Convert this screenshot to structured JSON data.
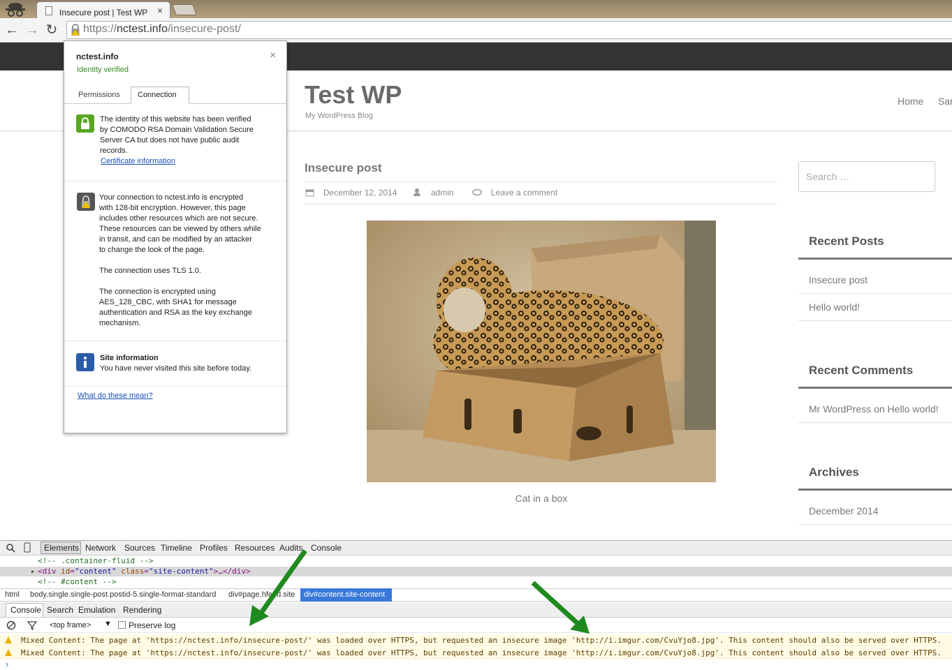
{
  "browser": {
    "tab_title": "Insecure post | Test WP",
    "tab_close": "×",
    "url_scheme": "https://",
    "url_host": "nctest.info",
    "url_path": "/insecure-post/",
    "nav_icons": [
      "back-icon",
      "forward-icon",
      "reload-icon",
      "warning-lock-icon"
    ]
  },
  "site": {
    "title": "Test WP",
    "tagline": "My WordPress Blog",
    "nav": [
      "Home",
      "Sar"
    ],
    "post": {
      "title": "Insecure post",
      "date": "December 12, 2014",
      "author": "admin",
      "comment_link": "Leave a comment",
      "caption": "Cat in a box"
    },
    "sidebar": {
      "search_placeholder": "Search …",
      "recent_posts_title": "Recent Posts",
      "recent_posts": [
        "Insecure post",
        "Hello world!"
      ],
      "recent_comments_title": "Recent Comments",
      "recent_comment": "Mr WordPress on Hello world!",
      "archives_title": "Archives",
      "archives": [
        "December 2014"
      ]
    }
  },
  "popup": {
    "domain": "nctest.info",
    "status": "Identity verified",
    "close": "×",
    "tabs": [
      "Permissions",
      "Connection"
    ],
    "identity_lines": [
      "The identity of this website has been verified",
      "by COMODO RSA Domain Validation Secure",
      "Server CA but does not have public audit",
      "records."
    ],
    "cert_link": "Certificate information",
    "conn_lines": [
      "Your connection to nctest.info is encrypted",
      "with 128-bit encryption. However, this page",
      "includes other resources which are not secure.",
      "These resources can be viewed by others while",
      "in transit, and can be modified by an attacker",
      "to change the look of the page."
    ],
    "tls_line": "The connection uses TLS 1.0.",
    "cipher_lines": [
      "The connection is encrypted using",
      "AES_128_CBC, with SHA1 for message",
      "authentication and RSA as the key exchange",
      "mechanism."
    ],
    "site_info_title": "Site information",
    "site_info_text": "You have never visited this site before today.",
    "help_link": "What do these mean?"
  },
  "devtools": {
    "tabs": [
      "Elements",
      "Network",
      "Sources",
      "Timeline",
      "Profiles",
      "Resources",
      "Audits",
      "Console"
    ],
    "dom_lines": [
      "<!-- .container-fluid -->",
      "<!-- #content -->"
    ],
    "sel_tag_open": "<div ",
    "sel_attr1_name": "id",
    "sel_attr1_val": "\"content\"",
    "sel_attr2_name": "class",
    "sel_attr2_val": "\"site-content\"",
    "sel_tag_close": ">…</div>",
    "breadcrumbs": [
      "html",
      "body.single.single-post.postid-5.single-format-standard",
      "div#page.hfeed.site",
      "div#content.site-content"
    ],
    "drawer_tabs": [
      "Console",
      "Search",
      "Emulation",
      "Rendering"
    ],
    "frame": "<top frame>",
    "preserve_log": "Preserve log",
    "messages": [
      {
        "prefix": "Mixed Content: The page at '",
        "page_url": "https://nctest.info/insecure-post/",
        "middle": "' was loaded over HTTPS, but requested an insecure image '",
        "img_url": "http://i.imgur.com/CvuYjo8.jpg",
        "suffix": "'. This content should also be served over HTTPS."
      },
      {
        "prefix": "Mixed Content: The page at '",
        "page_url": "https://nctest.info/insecure-post/",
        "middle": "' was loaded over HTTPS, but requested an insecure image '",
        "img_url": "http://i.imgur.com/CvuYjo8.jpg",
        "suffix": "'. This content should also be served over HTTPS."
      }
    ],
    "prompt": "›"
  },
  "colors": {
    "arrow": "#1f8a1f",
    "selection": "#3879d9",
    "warning": "#e8b200"
  }
}
